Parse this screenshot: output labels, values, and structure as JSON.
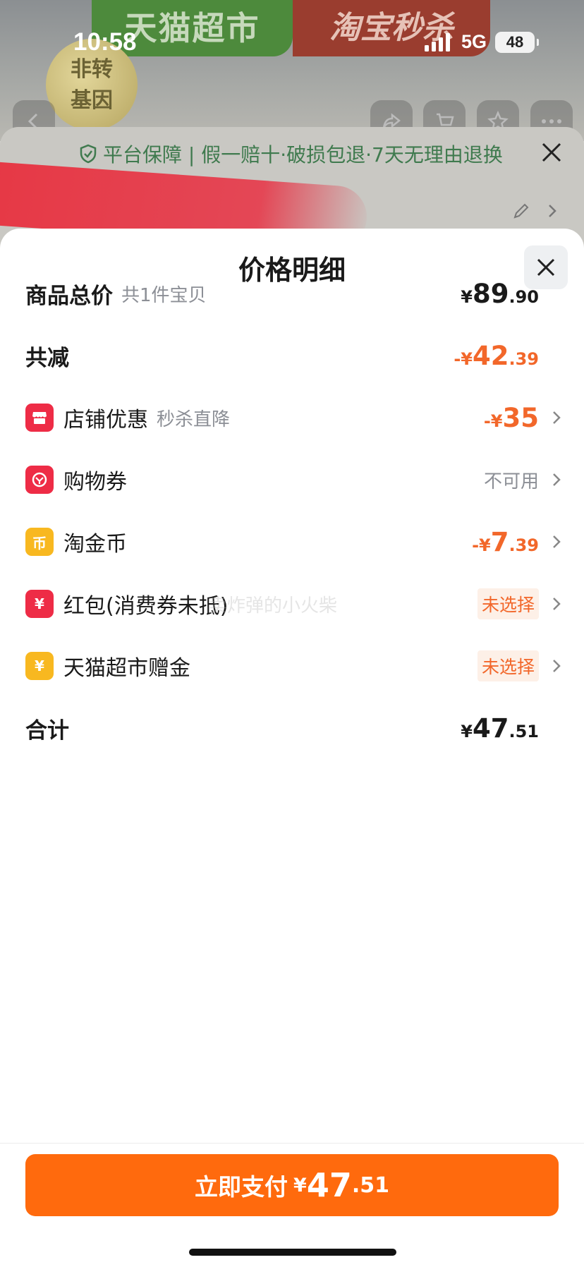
{
  "status_bar": {
    "time": "10:58",
    "network": "5G",
    "battery": "48"
  },
  "background": {
    "banner_left": "天猫超市",
    "banner_right": "淘宝秒杀",
    "badge_text": "非转\n基因",
    "guarantee": "平台保障 | 假一赔十·破损包退·7天无理由退换"
  },
  "sheet": {
    "title": "价格明细",
    "rows": {
      "total_goods": {
        "label": "商品总价",
        "sub": "共1件宝贝",
        "currency": "¥",
        "int": "89",
        "dec": ".90"
      },
      "total_discount": {
        "label": "共减",
        "currency": "-¥",
        "int": "42",
        "dec": ".39"
      },
      "shop_discount": {
        "label": "店铺优惠",
        "sub": "秒杀直降",
        "currency": "-¥",
        "int": "35",
        "icon": "shop-icon"
      },
      "shopping_coupon": {
        "label": "购物券",
        "status": "不可用",
        "icon": "coupon-icon"
      },
      "taojin_coin": {
        "label": "淘金币",
        "currency": "-¥",
        "int": "7",
        "dec": ".39",
        "icon": "coin-icon",
        "icon_glyph": "币"
      },
      "red_packet": {
        "label": "红包(消费券未抵)",
        "status": "未选择",
        "icon": "red-packet-icon",
        "icon_glyph": "¥"
      },
      "tmall_gift": {
        "label": "天猫超市赠金",
        "status": "未选择",
        "icon": "gift-money-icon",
        "icon_glyph": "¥"
      },
      "total": {
        "label": "合计",
        "currency": "¥",
        "int": "47",
        "dec": ".51"
      }
    }
  },
  "watermark": "卖炸弹的小火柴",
  "pay_button": {
    "label": "立即支付",
    "currency": "¥",
    "int": "47",
    "dec": ".51"
  },
  "colors": {
    "accent": "#ff6a0d",
    "discount": "#f2672a",
    "icon_red": "#ee2c46",
    "icon_yellow": "#f8b820"
  }
}
